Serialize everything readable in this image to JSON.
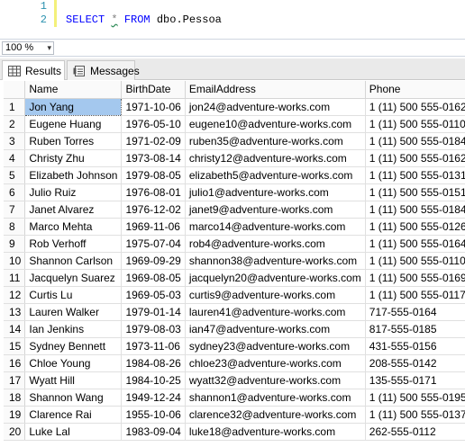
{
  "editor": {
    "line_numbers": [
      "1",
      "2"
    ],
    "code": {
      "kw_select": "SELECT",
      "star": "*",
      "kw_from": "FROM",
      "table": "dbo.Pessoa"
    }
  },
  "zoom": {
    "value": "100 %",
    "arrow": "▾"
  },
  "tabs": [
    {
      "label": "Results",
      "icon": "grid-icon",
      "active": true
    },
    {
      "label": "Messages",
      "icon": "messages-icon",
      "active": false
    }
  ],
  "grid": {
    "columns": [
      "Name",
      "BirthDate",
      "EmailAddress",
      "Phone"
    ],
    "rows": [
      [
        "1",
        "Jon Yang",
        "1971-10-06",
        "jon24@adventure-works.com",
        "1 (11) 500 555-0162"
      ],
      [
        "2",
        "Eugene Huang",
        "1976-05-10",
        "eugene10@adventure-works.com",
        "1 (11) 500 555-0110"
      ],
      [
        "3",
        "Ruben Torres",
        "1971-02-09",
        "ruben35@adventure-works.com",
        "1 (11) 500 555-0184"
      ],
      [
        "4",
        "Christy Zhu",
        "1973-08-14",
        "christy12@adventure-works.com",
        "1 (11) 500 555-0162"
      ],
      [
        "5",
        "Elizabeth Johnson",
        "1979-08-05",
        "elizabeth5@adventure-works.com",
        "1 (11) 500 555-0131"
      ],
      [
        "6",
        "Julio Ruiz",
        "1976-08-01",
        "julio1@adventure-works.com",
        "1 (11) 500 555-0151"
      ],
      [
        "7",
        "Janet Alvarez",
        "1976-12-02",
        "janet9@adventure-works.com",
        "1 (11) 500 555-0184"
      ],
      [
        "8",
        "Marco Mehta",
        "1969-11-06",
        "marco14@adventure-works.com",
        "1 (11) 500 555-0126"
      ],
      [
        "9",
        "Rob Verhoff",
        "1975-07-04",
        "rob4@adventure-works.com",
        "1 (11) 500 555-0164"
      ],
      [
        "10",
        "Shannon Carlson",
        "1969-09-29",
        "shannon38@adventure-works.com",
        "1 (11) 500 555-0110"
      ],
      [
        "11",
        "Jacquelyn Suarez",
        "1969-08-05",
        "jacquelyn20@adventure-works.com",
        "1 (11) 500 555-0169"
      ],
      [
        "12",
        "Curtis Lu",
        "1969-05-03",
        "curtis9@adventure-works.com",
        "1 (11) 500 555-0117"
      ],
      [
        "13",
        "Lauren Walker",
        "1979-01-14",
        "lauren41@adventure-works.com",
        "717-555-0164"
      ],
      [
        "14",
        "Ian Jenkins",
        "1979-08-03",
        "ian47@adventure-works.com",
        "817-555-0185"
      ],
      [
        "15",
        "Sydney Bennett",
        "1973-11-06",
        "sydney23@adventure-works.com",
        "431-555-0156"
      ],
      [
        "16",
        "Chloe Young",
        "1984-08-26",
        "chloe23@adventure-works.com",
        "208-555-0142"
      ],
      [
        "17",
        "Wyatt Hill",
        "1984-10-25",
        "wyatt32@adventure-works.com",
        "135-555-0171"
      ],
      [
        "18",
        "Shannon Wang",
        "1949-12-24",
        "shannon1@adventure-works.com",
        "1 (11) 500 555-0195"
      ],
      [
        "19",
        "Clarence Rai",
        "1955-10-06",
        "clarence32@adventure-works.com",
        "1 (11) 500 555-0137"
      ],
      [
        "20",
        "Luke Lal",
        "1983-09-04",
        "luke18@adventure-works.com",
        "262-555-0112"
      ]
    ],
    "selected": {
      "row": 0,
      "col": 1
    }
  },
  "colors": {
    "keyword": "#0000ff",
    "line_number": "#2b91af",
    "selection": "#a4c8ee"
  }
}
